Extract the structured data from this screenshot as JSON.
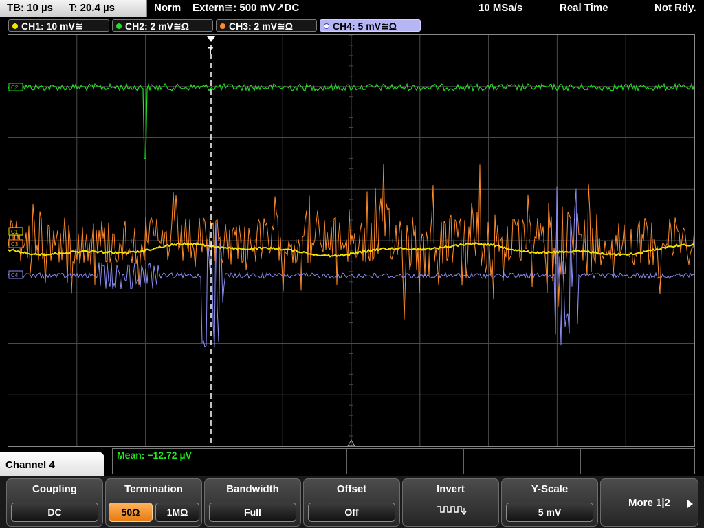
{
  "topbar": {
    "timebase": "TB: 10 µs",
    "trigger_time": "T: 20.4 µs",
    "trigger_mode": "Norm",
    "trigger_source": "Extern≅: 500 mV↗DC",
    "sample_rate": "10 MSa/s",
    "acq_mode": "Real Time",
    "status": "Not Rdy."
  },
  "channels": [
    {
      "label": "CH1: 10 mV≅",
      "color": "#f2e200"
    },
    {
      "label": "CH2: 2 mV≅Ω",
      "color": "#22dd22"
    },
    {
      "label": "CH3: 2 mV≅Ω",
      "color": "#ff8a2a"
    },
    {
      "label": "CH4: 5 mV≅Ω",
      "color": "#8c8cf0"
    }
  ],
  "screen_markers": {
    "trigger_marker": "T",
    "ch1": "C1",
    "ch2": "C2",
    "ch3": "C3",
    "ch4": "C4"
  },
  "measurement": {
    "mean": "Mean: −12.72 µV"
  },
  "menu": {
    "channel_title": "Channel 4",
    "coupling": {
      "title": "Coupling",
      "value": "DC"
    },
    "termination": {
      "title": "Termination",
      "options": [
        "50Ω",
        "1MΩ"
      ],
      "selected": "50Ω"
    },
    "bandwidth": {
      "title": "Bandwidth",
      "value": "Full"
    },
    "offset": {
      "title": "Offset",
      "value": "Off"
    },
    "invert": {
      "title": "Invert",
      "icon": "inverted-square-wave-icon"
    },
    "yscale": {
      "title": "Y-Scale",
      "value": "5 mV"
    },
    "more": {
      "label": "More 1|2",
      "icon": "right-arrow-icon"
    }
  },
  "colors": {
    "grid": "#4a4a4a",
    "trigger_line": "#ffffff"
  }
}
